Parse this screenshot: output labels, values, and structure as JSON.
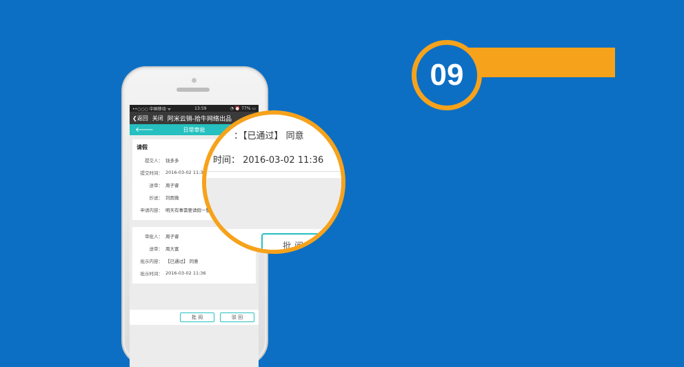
{
  "badge": {
    "number": "09"
  },
  "phone": {
    "status": {
      "carrier": "••○○○ 中国移动 ᯤ",
      "time": "13:59",
      "battery": "◔ ⏰ 77% ▭"
    },
    "titlebar": {
      "back": "返回",
      "close": "关闭",
      "title": "阿米云销-拾牛网络出品",
      "more": "•••"
    },
    "navbar": {
      "back_icon": "🡐",
      "title": "日常审批"
    },
    "request": {
      "section_title": "请假",
      "rows": [
        {
          "label": "提交人：",
          "value": "钱多多"
        },
        {
          "label": "提交时间：",
          "value": "2016-03-02 11:36"
        },
        {
          "label": "送审：",
          "value": "周子睿"
        },
        {
          "label": "抄送：",
          "value": "刘雨微"
        },
        {
          "label": "申请内容：",
          "value": "明天有事需要请假一整"
        }
      ]
    },
    "approval": {
      "rows": [
        {
          "label": "审批人：",
          "value": "周子睿"
        },
        {
          "label": "送审：",
          "value": "周大富"
        },
        {
          "label": "批示内容：",
          "value": "【已通过】 同意"
        },
        {
          "label": "批示时间：",
          "value": "2016-03-02 11:36"
        }
      ]
    },
    "actions": {
      "approve": "批 阅",
      "reject": "驳 回"
    }
  },
  "magnifier": {
    "line1": "：【已通过】 同意",
    "line2": "时间： 2016-03-02 11:36",
    "button": "批 阅"
  },
  "colors": {
    "background": "#0d6fc4",
    "accent": "#f7a21b",
    "teal": "#25c0bf"
  }
}
